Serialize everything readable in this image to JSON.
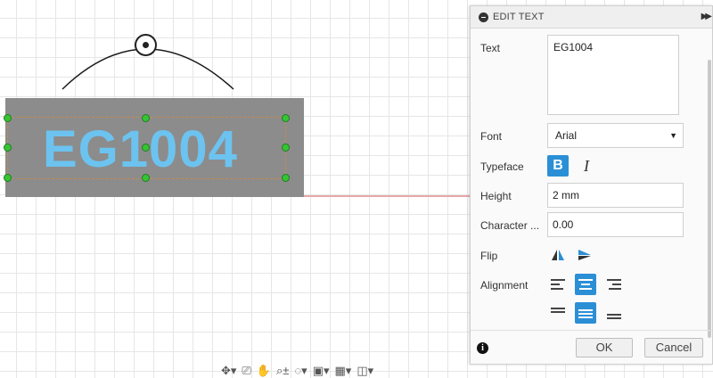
{
  "sketch": {
    "text_body": "EG1004"
  },
  "panel": {
    "title": "EDIT TEXT",
    "text_label": "Text",
    "text_value": "EG1004",
    "font_label": "Font",
    "font_value": "Arial",
    "typeface_label": "Typeface",
    "bold_glyph": "B",
    "italic_glyph": "I",
    "height_label": "Height",
    "height_value": "2 mm",
    "char_spacing_label": "Character ...",
    "char_spacing_value": "0.00",
    "flip_label": "Flip",
    "alignment_label": "Alignment",
    "ok_label": "OK",
    "cancel_label": "Cancel"
  },
  "colors": {
    "accent": "#2b8fd6",
    "text_fill": "#6cc3ef",
    "plate": "#8c8c8c",
    "handle": "#36c434"
  },
  "icons": {
    "collapse": "collapse-circle-icon",
    "expand": "double-chevron-right-icon",
    "info": "info-icon",
    "flip_horizontal": "flip-horizontal-icon",
    "flip_vertical": "flip-vertical-icon"
  }
}
